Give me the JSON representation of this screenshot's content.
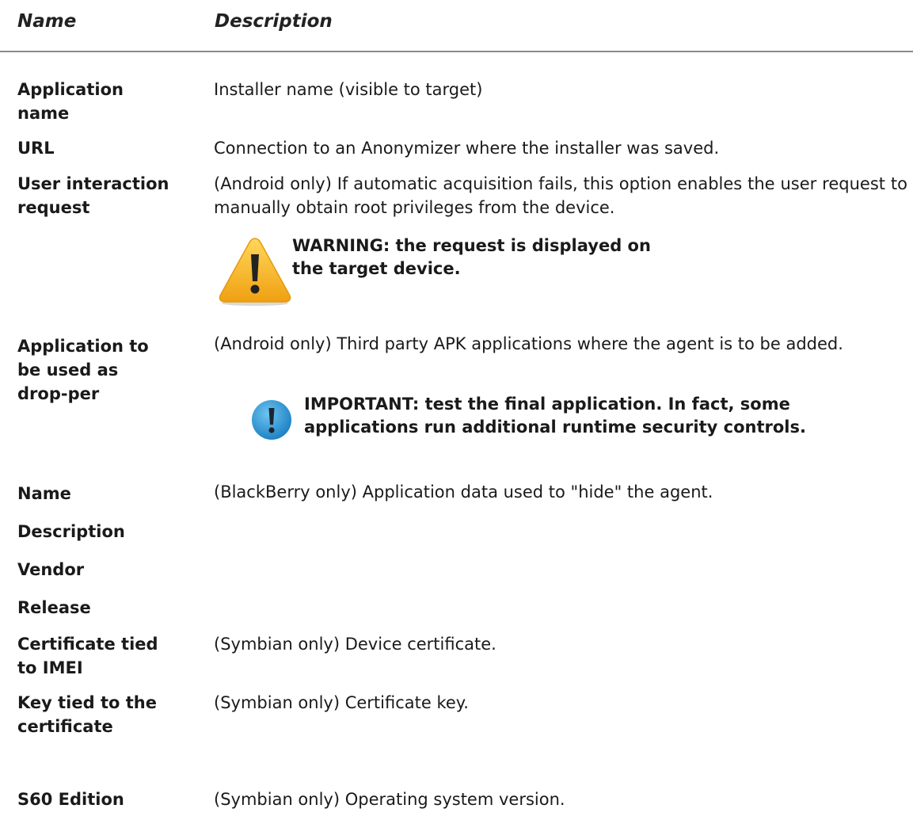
{
  "header": {
    "name_label": "Name",
    "description_label": "Description"
  },
  "rows": [
    {
      "term": "Application name",
      "description": "Installer name (visible to target)"
    },
    {
      "term": "URL",
      "description": "Connection to an Anonymizer where the installer was saved."
    },
    {
      "term": "User interaction request",
      "description": "(Android only) If automatic acquisition fails, this option enables the user request to manually obtain root privileges from the device."
    },
    {
      "term": "Application to be used as drop-per",
      "description": "(Android only) Third party APK applications where the agent is to be added."
    },
    {
      "term": "Name",
      "description": "(BlackBerry only) Application data used to \"hide\" the agent."
    },
    {
      "term": "Description",
      "description": ""
    },
    {
      "term": "Vendor",
      "description": ""
    },
    {
      "term": "Release",
      "description": ""
    },
    {
      "term": "Certificate tied to IMEI",
      "description": "(Symbian only) Device certificate."
    },
    {
      "term": "Key tied to the certificate",
      "description": "(Symbian only) Certificate key."
    },
    {
      "term": "S60 Edition",
      "description": "(Symbian only) Operating system version."
    }
  ],
  "notes": {
    "warning": "WARNING: the request is displayed on the target device.",
    "important": "IMPORTANT:  test the final application. In fact, some applications run additional runtime security controls."
  },
  "icons": {
    "warning": "warning-triangle-icon",
    "important": "exclamation-circle-icon"
  }
}
